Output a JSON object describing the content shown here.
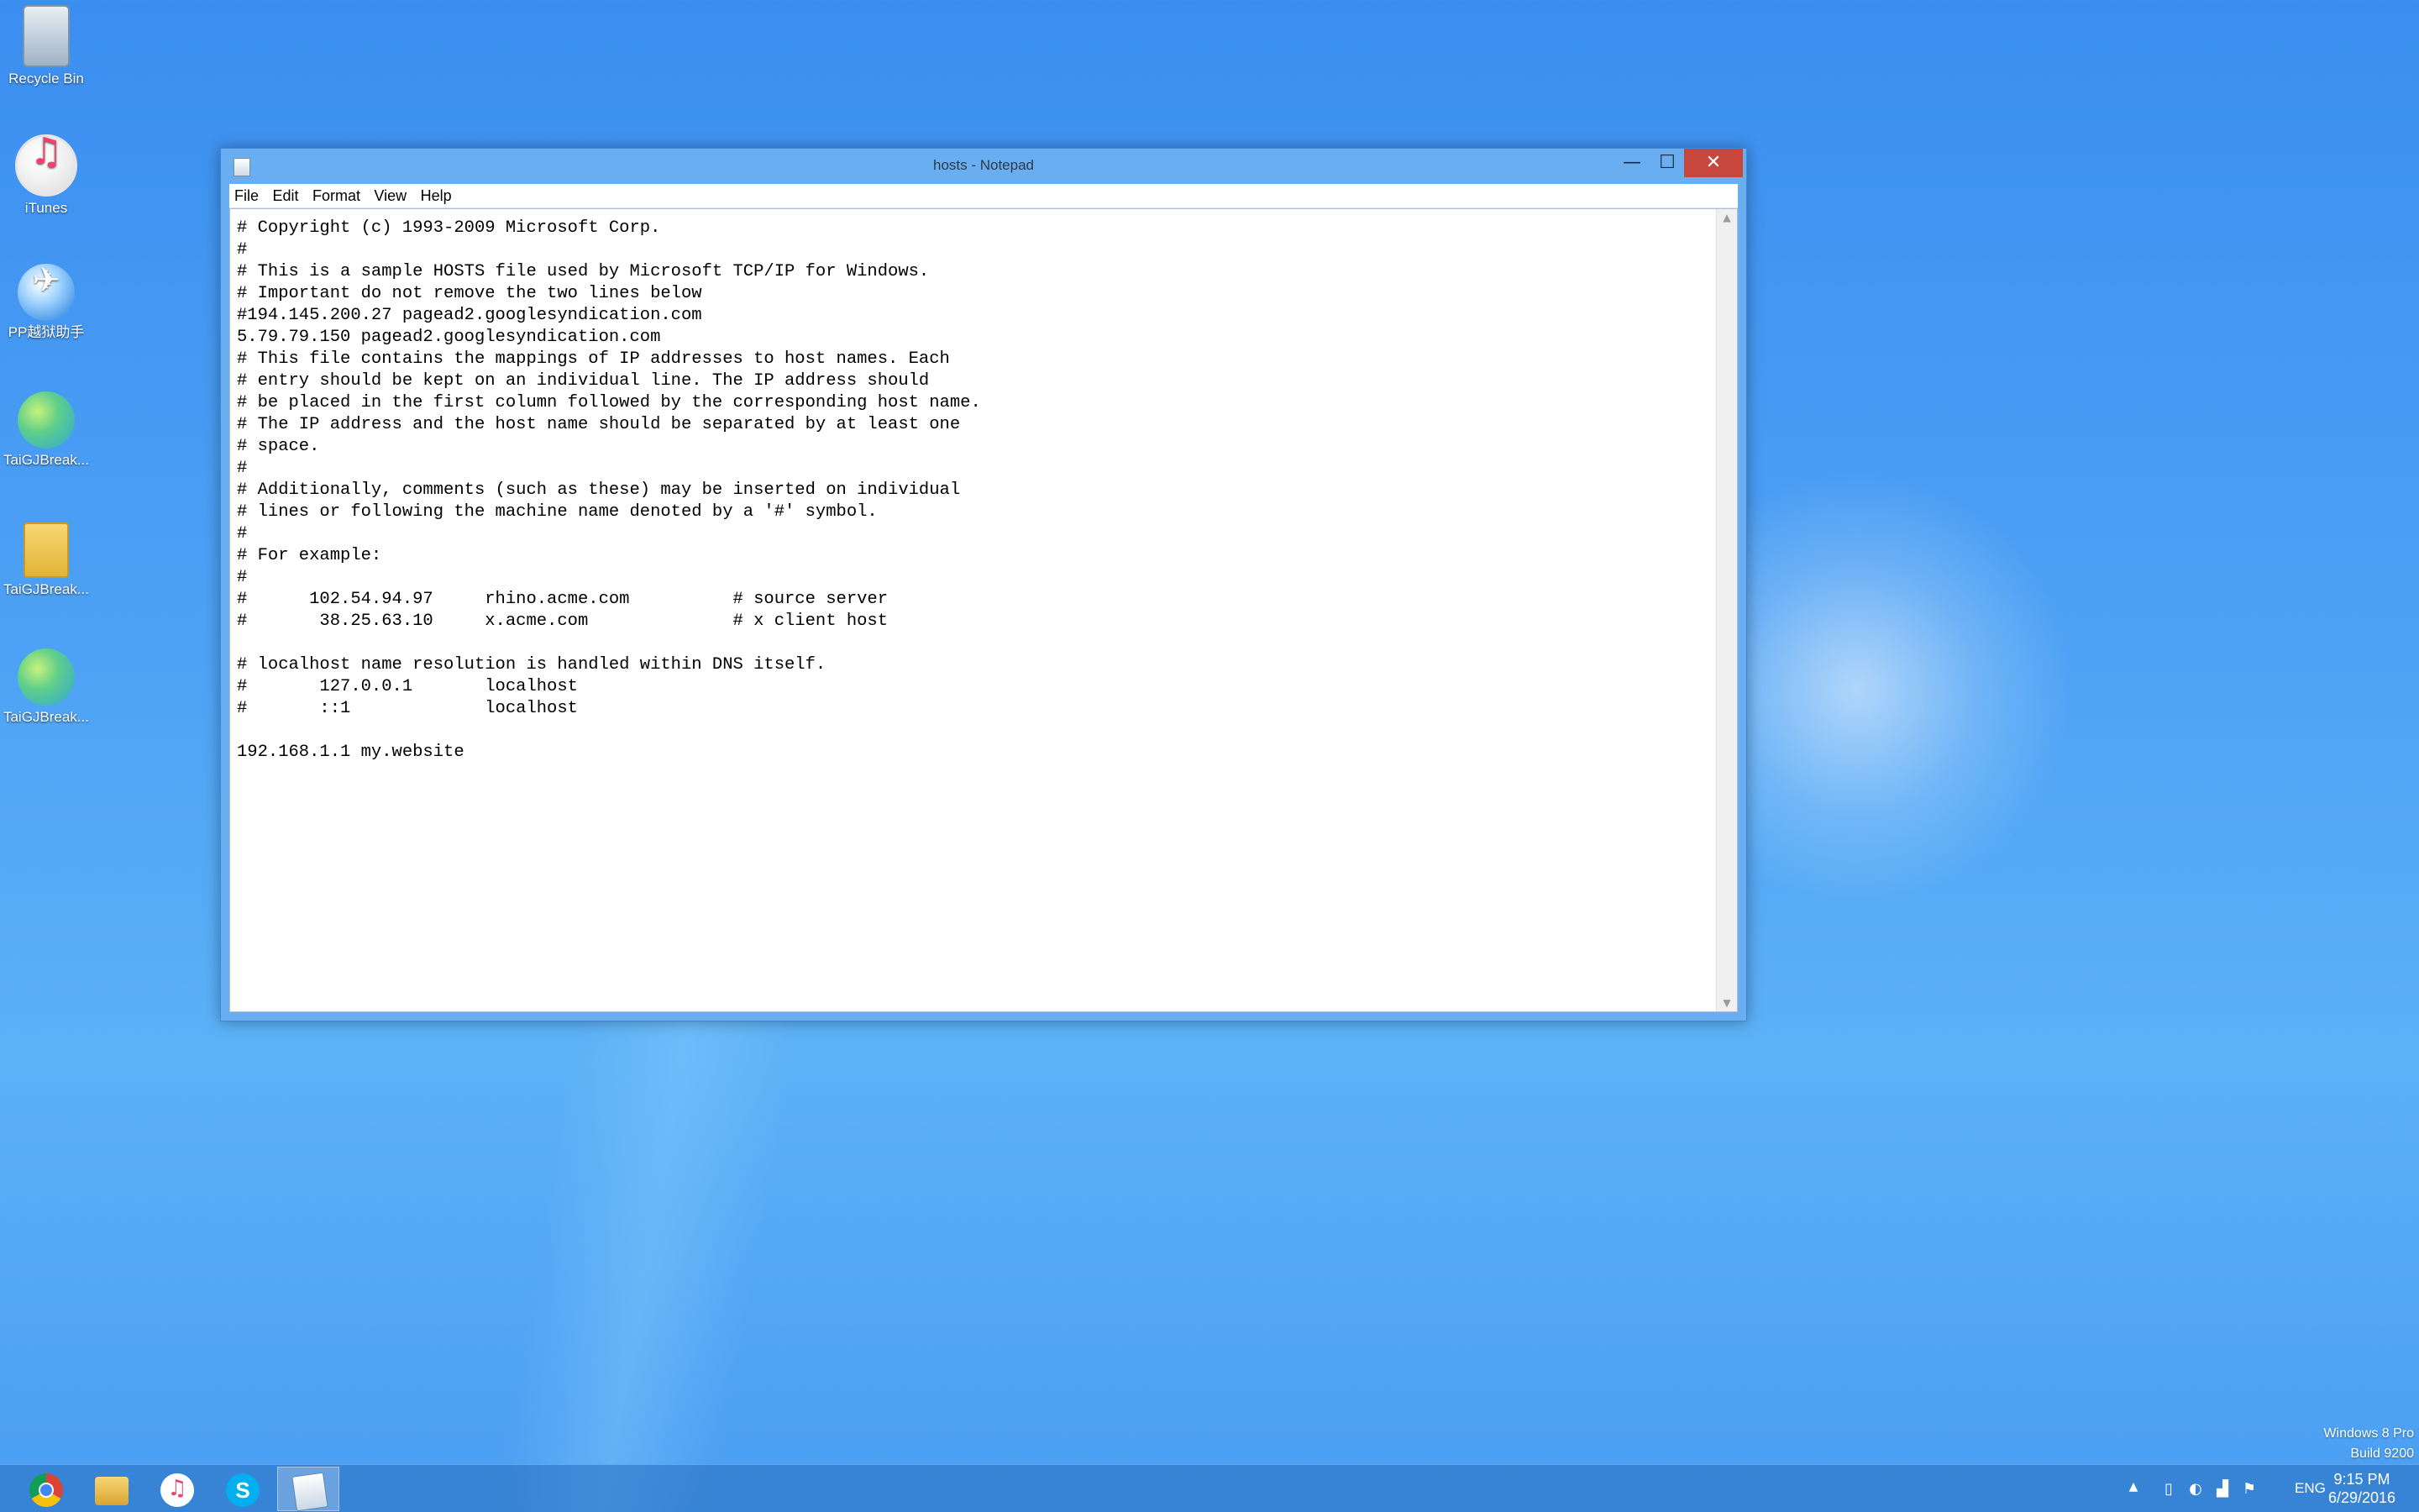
{
  "desktop": {
    "icons": [
      {
        "label": "Recycle Bin",
        "icon": "recycle-bin-icon"
      },
      {
        "label": "iTunes",
        "icon": "itunes-icon"
      },
      {
        "label": "PP越狱助手",
        "icon": "pp-assistant-icon"
      },
      {
        "label": "TaiGJBreak...",
        "icon": "taig-icon"
      },
      {
        "label": "TaiGJBreak...",
        "icon": "folder-icon"
      },
      {
        "label": "TaiGJBreak...",
        "icon": "taig-icon"
      }
    ]
  },
  "window": {
    "title": "hosts - Notepad",
    "controls": {
      "minimize": "—",
      "maximize": "☐",
      "close": "✕"
    },
    "menu": [
      "File",
      "Edit",
      "Format",
      "View",
      "Help"
    ],
    "content": "# Copyright (c) 1993-2009 Microsoft Corp.\n#\n# This is a sample HOSTS file used by Microsoft TCP/IP for Windows.\n# Important do not remove the two lines below\n#194.145.200.27 pagead2.googlesyndication.com\n5.79.79.150 pagead2.googlesyndication.com\n# This file contains the mappings of IP addresses to host names. Each\n# entry should be kept on an individual line. The IP address should\n# be placed in the first column followed by the corresponding host name.\n# The IP address and the host name should be separated by at least one\n# space.\n#\n# Additionally, comments (such as these) may be inserted on individual\n# lines or following the machine name denoted by a '#' symbol.\n#\n# For example:\n#\n#      102.54.94.97     rhino.acme.com          # source server\n#       38.25.63.10     x.acme.com              # x client host\n\n# localhost name resolution is handled within DNS itself.\n#       127.0.0.1       localhost\n#       ::1             localhost\n\n192.168.1.1 my.website"
  },
  "watermark": {
    "line1": "Windows 8 Pro",
    "line2": "Build 9200"
  },
  "taskbar": {
    "apps": [
      {
        "name": "chrome-icon"
      },
      {
        "name": "file-explorer-icon"
      },
      {
        "name": "itunes-icon"
      },
      {
        "name": "skype-icon"
      },
      {
        "name": "notepad-icon",
        "active": true
      }
    ],
    "tray": {
      "overflow": "▲",
      "language": "ENG",
      "time": "9:15 PM",
      "date": "6/29/2016"
    }
  }
}
